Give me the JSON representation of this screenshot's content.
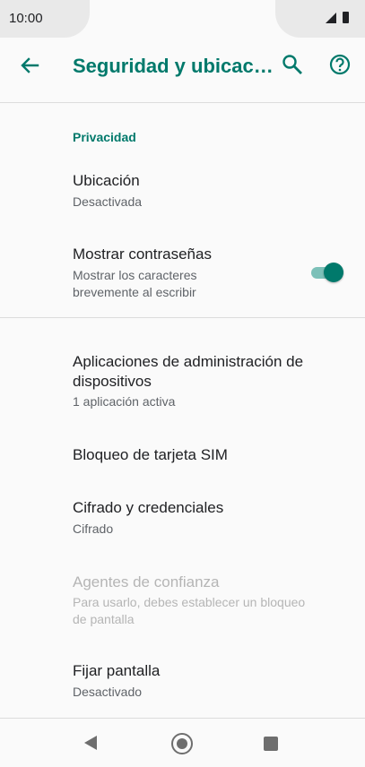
{
  "status_bar": {
    "time": "10:00"
  },
  "app_bar": {
    "title": "Seguridad y ubicac…"
  },
  "section": {
    "header": "Privacidad"
  },
  "items": [
    {
      "title": "Ubicación",
      "subtitle": "Desactivada"
    },
    {
      "title": "Mostrar contraseñas",
      "subtitle_line1": "Mostrar los caracteres",
      "subtitle_line2": "brevemente al escribir",
      "toggle_on": true
    },
    {
      "title_line1": "Aplicaciones de administración de",
      "title_line2": "dispositivos",
      "subtitle": "1 aplicación activa"
    },
    {
      "title": "Bloqueo de tarjeta SIM"
    },
    {
      "title": "Cifrado y credenciales",
      "subtitle": "Cifrado"
    },
    {
      "title": "Agentes de confianza",
      "subtitle_line1": "Para usarlo, debes establecer un bloqueo",
      "subtitle_line2": "de pantalla",
      "disabled": true
    },
    {
      "title": "Fijar pantalla",
      "subtitle": "Desactivado"
    }
  ],
  "colors": {
    "accent": "#00796b",
    "toggle_track": "#7cc0b8"
  },
  "icons": [
    "back-arrow-icon",
    "search-icon",
    "help-icon",
    "signal-icon",
    "battery-icon",
    "nav-back-icon",
    "nav-home-icon",
    "nav-recents-icon"
  ]
}
